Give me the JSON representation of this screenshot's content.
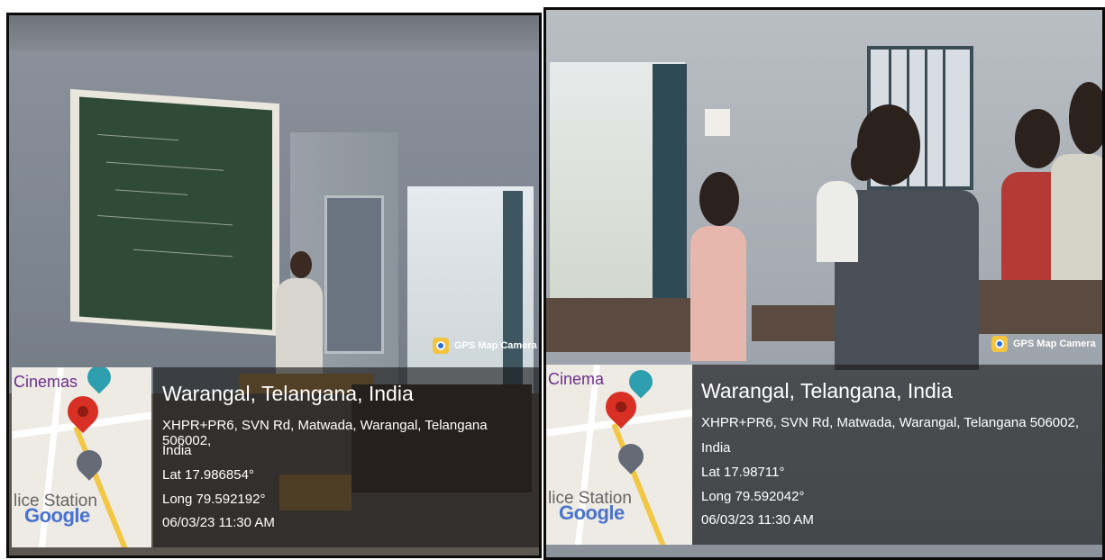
{
  "panels": [
    {
      "camera_label": "GPS Map Camera",
      "map": {
        "poi_top": "Cinemas",
        "poi_bottom": "lice Station",
        "brand": "Google"
      },
      "location": {
        "title": "Warangal, Telangana, India",
        "address_line1": "XHPR+PR6, SVN Rd, Matwada, Warangal, Telangana 506002,",
        "address_line2": "India",
        "lat": "Lat 17.986854°",
        "long": "Long 79.592192°",
        "datetime": "06/03/23 11:30 AM"
      }
    },
    {
      "camera_label": "GPS Map Camera",
      "map": {
        "poi_top": "Cinema",
        "poi_bottom": "lice Station",
        "brand": "Google"
      },
      "location": {
        "title": "Warangal, Telangana, India",
        "address_line1": "XHPR+PR6, SVN Rd, Matwada, Warangal, Telangana 506002,",
        "address_line2": "India",
        "lat": "Lat 17.98711°",
        "long": "Long 79.592042°",
        "datetime": "06/03/23 11:30 AM"
      }
    }
  ]
}
